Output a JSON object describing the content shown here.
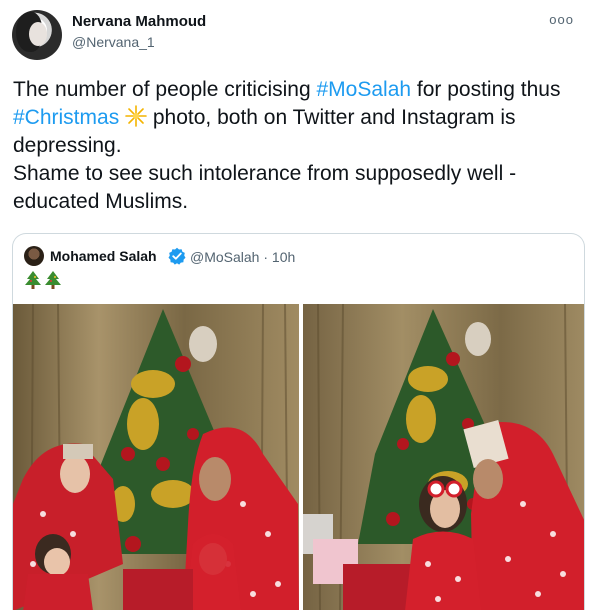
{
  "author": {
    "name": "Nervana Mahmoud",
    "handle": "@Nervana_1",
    "more_label": "ooo"
  },
  "tweet": {
    "text_1": "The number of people criticising ",
    "hashtag_1": "#MoSalah",
    "text_2": " for posting thus ",
    "hashtag_2": "#Christmas",
    "text_3": " photo, both on Twitter and Instagram is depressing.",
    "text_4": "Shame to see such intolerance from supposedly well - educated Muslims."
  },
  "quoted_tweet": {
    "name": "Mohamed Salah",
    "handle_time": "@MoSalah · 10h"
  },
  "colors": {
    "link": "#1d9bf0",
    "text": "#0f1419",
    "secondary": "#536471",
    "border": "#cfd9de"
  },
  "icons": [
    "more-options-icon",
    "sparkle-emoji-icon",
    "verified-badge-icon",
    "christmas-tree-emoji-icon"
  ]
}
